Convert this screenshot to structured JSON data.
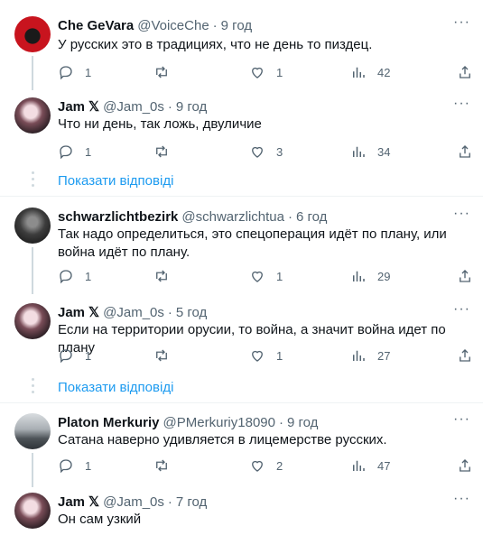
{
  "tweets": [
    {
      "name": "Che GeVara",
      "verified_x": "",
      "handle": "@VoiceChe",
      "sep": "·",
      "time": "9 год",
      "text": "У русских это в традициях, что не день то пиздец.",
      "replies": "1",
      "retweets": "",
      "likes": "1",
      "views": "42"
    },
    {
      "name": "Jam",
      "verified_x": "𝕏",
      "handle": "@Jam_0s",
      "sep": "·",
      "time": "9 год",
      "text": "Что ни день, так ложь, двуличие",
      "replies": "1",
      "retweets": "",
      "likes": "3",
      "views": "34"
    },
    {
      "name": "schwarzlichtbezirk",
      "verified_x": "",
      "handle": "@schwarzlichtua",
      "sep": "·",
      "time": "6 год",
      "text": "Так надо определиться, это спецоперация идёт по плану, или война идёт по плану.",
      "replies": "1",
      "retweets": "",
      "likes": "1",
      "views": "29"
    },
    {
      "name": "Jam",
      "verified_x": "𝕏",
      "handle": "@Jam_0s",
      "sep": "·",
      "time": "5 год",
      "text": "Если на территории орусии, то война, а значит война идет по плану",
      "replies": "1",
      "retweets": "",
      "likes": "1",
      "views": "27"
    },
    {
      "name": "Platon Merkuriy",
      "verified_x": "",
      "handle": "@PMerkuriy18090",
      "sep": "·",
      "time": "9 год",
      "text": "Сатана наверно удивляется в лицемерстве русских.",
      "replies": "1",
      "retweets": "",
      "likes": "2",
      "views": "47"
    },
    {
      "name": "Jam",
      "verified_x": "𝕏",
      "handle": "@Jam_0s",
      "sep": "·",
      "time": "7 год",
      "text": "Он сам узкий",
      "replies": "",
      "retweets": "",
      "likes": "",
      "views": ""
    }
  ],
  "show_replies_label": "Показати відповіді",
  "more_glyph": "···",
  "icons": [
    "reply-icon",
    "retweet-icon",
    "like-icon",
    "views-icon",
    "share-icon",
    "more-icon"
  ],
  "colors": {
    "link": "#1d9bf0",
    "muted": "#536471",
    "text": "#0f1419",
    "divider": "#eff3f4"
  }
}
